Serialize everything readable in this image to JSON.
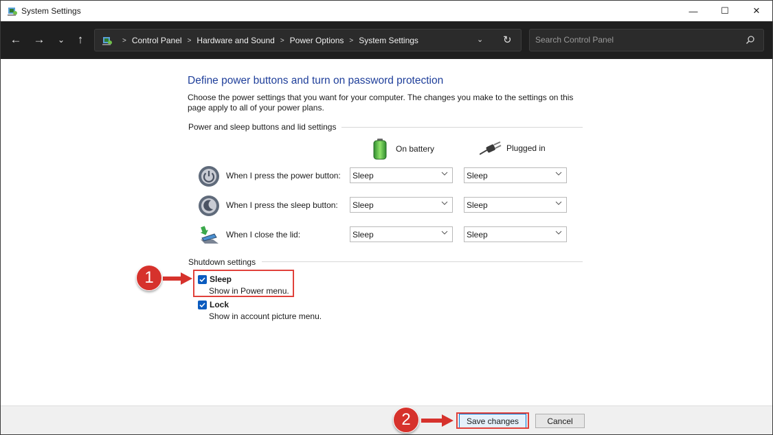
{
  "window": {
    "title": "System Settings",
    "minimize_glyph": "—",
    "maximize_glyph": "☐",
    "close_glyph": "✕"
  },
  "nav": {
    "back_glyph": "←",
    "forward_glyph": "→",
    "recent_glyph": "⌄",
    "up_glyph": "↑",
    "breadcrumb": [
      "Control Panel",
      "Hardware and Sound",
      "Power Options",
      "System Settings"
    ],
    "breadcrumb_sep": ">",
    "dropdown_glyph": "⌄",
    "refresh_glyph": "↻",
    "search_placeholder": "Search Control Panel"
  },
  "page": {
    "heading": "Define power buttons and turn on password protection",
    "description": "Choose the power settings that you want for your computer. The changes you make to the settings on this page apply to all of your power plans.",
    "power_section_label": "Power and sleep buttons and lid settings",
    "columns": {
      "battery": "On battery",
      "plugged": "Plugged in"
    },
    "rows": [
      {
        "label": "When I press the power button:",
        "battery": "Sleep",
        "plugged": "Sleep",
        "icon": "power-button-icon"
      },
      {
        "label": "When I press the sleep button:",
        "battery": "Sleep",
        "plugged": "Sleep",
        "icon": "sleep-button-icon"
      },
      {
        "label": "When I close the lid:",
        "battery": "Sleep",
        "plugged": "Sleep",
        "icon": "laptop-lid-icon"
      }
    ],
    "shutdown_section_label": "Shutdown settings",
    "shutdown_items": [
      {
        "title": "Sleep",
        "desc": "Show in Power menu.",
        "checked": true
      },
      {
        "title": "Lock",
        "desc": "Show in account picture menu.",
        "checked": true
      }
    ]
  },
  "footer": {
    "save_label": "Save changes",
    "cancel_label": "Cancel"
  },
  "annotations": {
    "step1": "1",
    "step2": "2",
    "color": "#d6322c"
  },
  "colors": {
    "heading": "#1e3e9a",
    "navbar": "#1f1f1f",
    "checkbox": "#0a5bbf"
  }
}
